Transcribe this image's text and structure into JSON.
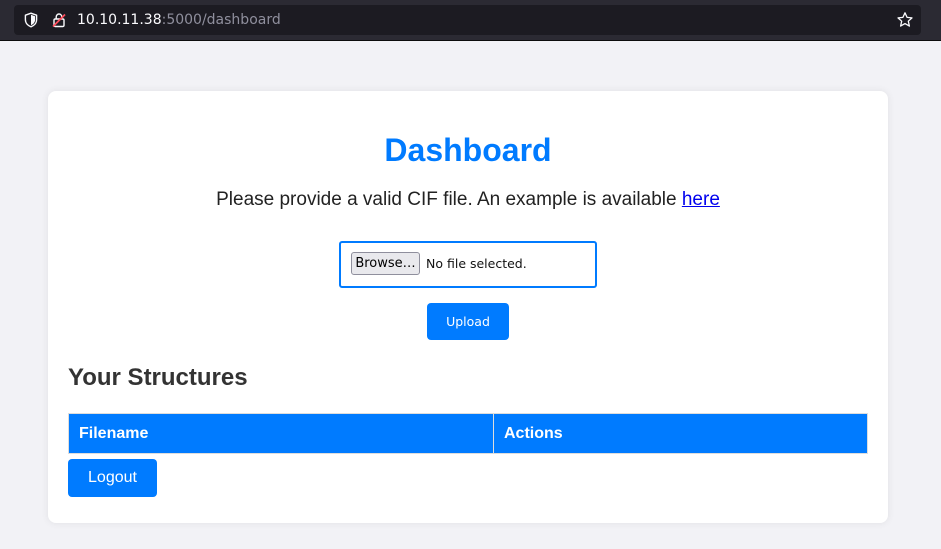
{
  "browser": {
    "url_host": "10.10.11.38",
    "url_rest": ":5000/dashboard",
    "icons": {
      "shield": "shield-icon",
      "lock": "lock-insecure-icon",
      "star": "bookmark-star-icon"
    }
  },
  "page": {
    "title": "Dashboard",
    "instructions_text": "Please provide a valid CIF file. An example is available ",
    "example_link": "here",
    "file_input": {
      "browse_label": "Browse…",
      "status": "No file selected."
    },
    "upload_label": "Upload",
    "structures_heading": "Your Structures",
    "table": {
      "columns": [
        "Filename",
        "Actions"
      ],
      "rows": []
    },
    "logout_label": "Logout"
  },
  "colors": {
    "accent": "#007bff",
    "link": "#0000ee",
    "page_background": "#f2f2f6",
    "browser_chrome": "#2b2a33"
  }
}
